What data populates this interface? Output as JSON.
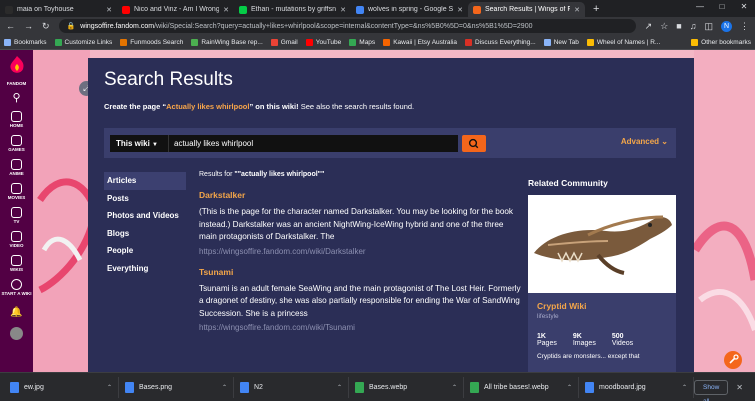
{
  "browser": {
    "tabs": [
      {
        "title": "maia on Toyhouse",
        "color": "#2b2b2b",
        "active": false
      },
      {
        "title": "Nico and Vinz - Am I Wrong",
        "color": "#ff0000",
        "active": false
      },
      {
        "title": "Ethan - mutations by griffsnuff",
        "color": "#05cc47",
        "active": false
      },
      {
        "title": "wolves in spring - Google Search",
        "color": "#4285f4",
        "active": false
      },
      {
        "title": "Search Results | Wings of Fire Wi",
        "color": "#f4661b",
        "active": true
      }
    ],
    "address": {
      "domain": "wingsoffire.fandom.com",
      "path": "/wiki/Special:Search?query=actually+likes+whirlpool&scope=internal&contentType=&ns%5B0%5D=0&ns%5B1%5D=2900"
    },
    "bookmarks": [
      {
        "label": "Bookmarks",
        "color": "#8ab4f8"
      },
      {
        "label": "Customize Links",
        "color": "#34a853"
      },
      {
        "label": "Funmoods Search",
        "color": "#e37400"
      },
      {
        "label": "RainWing Base rep...",
        "color": "#4caf50"
      },
      {
        "label": "Gmail",
        "color": "#ea4335"
      },
      {
        "label": "YouTube",
        "color": "#ff0000"
      },
      {
        "label": "Maps",
        "color": "#34a853"
      },
      {
        "label": "Kawaii | Etsy Australia",
        "color": "#f56400"
      },
      {
        "label": "Discuss Everything...",
        "color": "#d93025"
      },
      {
        "label": "New Tab",
        "color": "#8ab4f8"
      },
      {
        "label": "Wheel of Names | R...",
        "color": "#fbbc04"
      }
    ],
    "other_bookmarks": "Other bookmarks"
  },
  "rail": {
    "logo": "FANDOM",
    "items": [
      "HOME",
      "GAMES",
      "ANIME",
      "MOVIES",
      "TV",
      "VIDEO",
      "WIKIS",
      "START A WIKI"
    ]
  },
  "page": {
    "title": "Search Results",
    "create_prefix": "Create the page “",
    "create_term": "Actually likes whirlpool",
    "create_suffix": "” on this wiki!",
    "create_also": " See also the search results found.",
    "scope_label": "This wiki",
    "search_value": "actually likes whirlpool",
    "advanced_label": "Advanced",
    "nav": [
      "Articles",
      "Posts",
      "Photos and Videos",
      "Blogs",
      "People",
      "Everything"
    ],
    "results_for_prefix": "Results for ",
    "results_for_query": "\"\"actually likes whirlpool\"\"",
    "results": [
      {
        "title": "Darkstalker",
        "snippet": "(This is the page for the character named Darkstalker. You may be looking for the book instead.) Darkstalker was an ancient NightWing-IceWing hybrid and one of the three main protagonists of Darkstalker. The",
        "url": "https://wingsoffire.fandom.com/wiki/Darkstalker"
      },
      {
        "title": "Tsunami",
        "snippet": "Tsunami is an adult female SeaWing and the main protagonist of The Lost Heir. Formerly a dragonet of destiny, she was also partially responsible for ending the War of SandWing Succession. She is a princess",
        "url": "https://wingsoffire.fandom.com/wiki/Tsunami"
      }
    ],
    "related": {
      "heading": "Related Community",
      "name": "Cryptid Wiki",
      "tag": "lifestyle",
      "stats": [
        {
          "n": "1K",
          "l": "Pages"
        },
        {
          "n": "9K",
          "l": "Images"
        },
        {
          "n": "500",
          "l": "Videos"
        }
      ],
      "description": "Cryptids are monsters... except that"
    }
  },
  "downloads": [
    {
      "name": "ew.jpg",
      "color": "#4285f4"
    },
    {
      "name": "Bases.png",
      "color": "#4285f4"
    },
    {
      "name": "N2",
      "color": "#4285f4"
    },
    {
      "name": "Bases.webp",
      "color": "#34a853"
    },
    {
      "name": "All tribe bases!.webp",
      "color": "#34a853"
    },
    {
      "name": "moodboard.jpg",
      "color": "#4285f4"
    }
  ],
  "show_all_label": "Show all"
}
